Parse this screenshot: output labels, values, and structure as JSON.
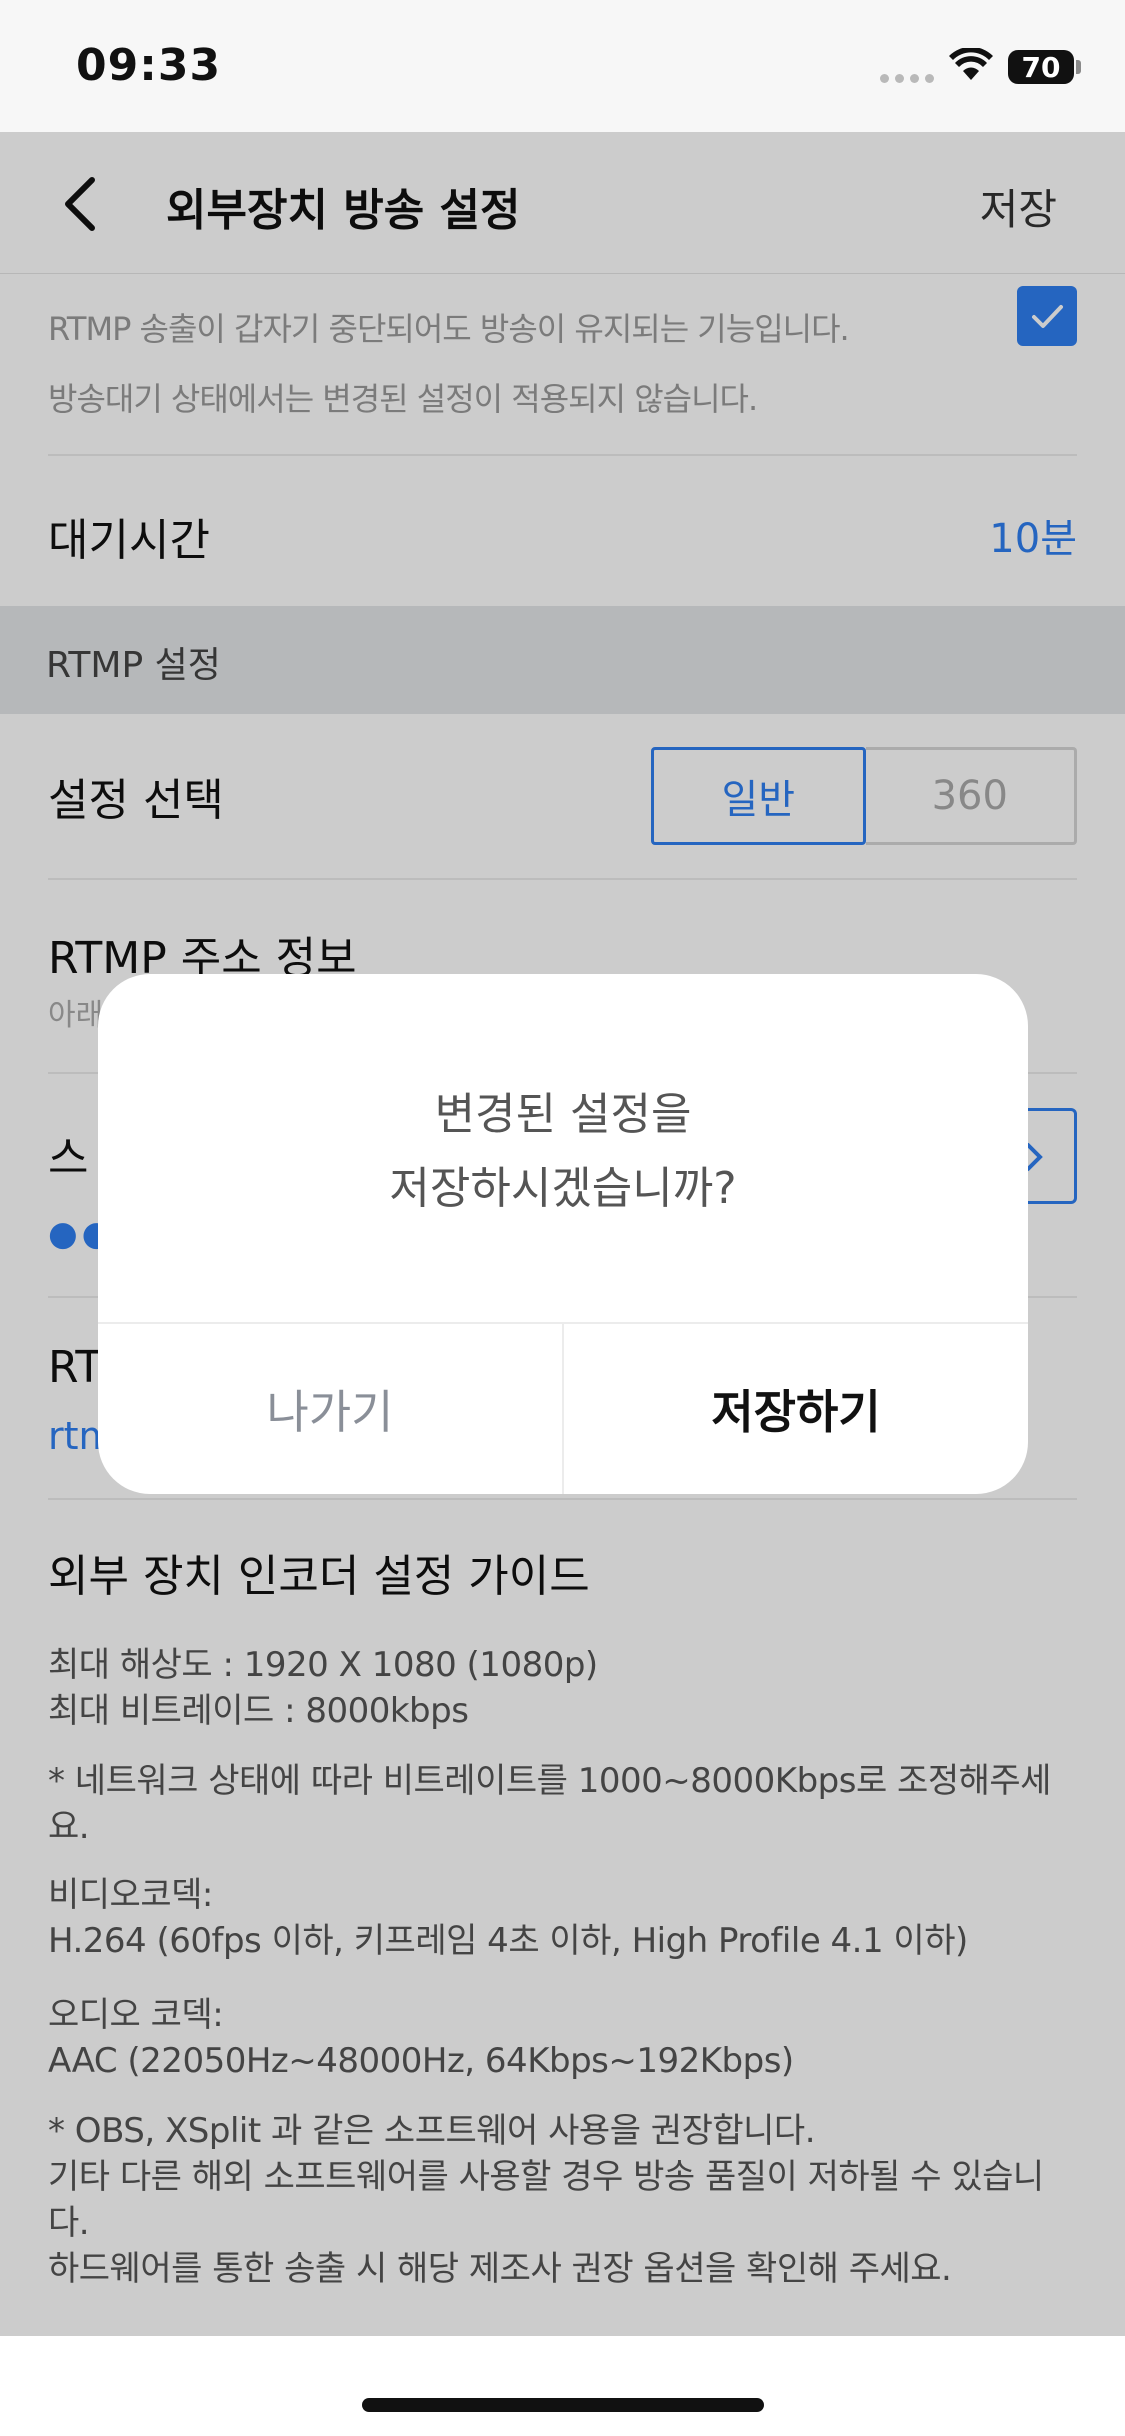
{
  "status_bar": {
    "time": "09:33",
    "battery": "70"
  },
  "nav": {
    "title": "외부장치 방송 설정",
    "save": "저장"
  },
  "description": {
    "line1": "RTMP 송출이 갑자기 중단되어도 방송이 유지되는 기능입니다.",
    "line2": "방송대기 상태에서는 변경된 설정이 적용되지 않습니다."
  },
  "wait_time": {
    "label": "대기시간",
    "value": "10분"
  },
  "section": {
    "title": "RTMP 설정"
  },
  "setting_select": {
    "label": "설정 선택",
    "options": [
      "일반",
      "360"
    ],
    "selected": "일반"
  },
  "rtmp_address": {
    "label": "RTMP 주소 정보",
    "sub_partial": "아래",
    "stream_partial": "스",
    "masked": "●●",
    "rt_partial": "RT",
    "link_partial": "rtm"
  },
  "guide": {
    "title": "외부 장치 인코더 설정 가이드",
    "resolution": "최대 해상도 : 1920 X 1080 (1080p)",
    "bitrate": "최대 비트레이드 : 8000kbps",
    "note1a": "* 네트워크 상태에 따라 비트레이트를 1000~8000Kbps로 조정해주세",
    "note1b": "요.",
    "video_codec_label": "비디오코덱:",
    "video_codec": "H.264 (60fps 이하, 키프레임 4초 이하, High Profile 4.1 이하)",
    "audio_codec_label": "오디오 코덱:",
    "audio_codec": "AAC (22050Hz~48000Hz, 64Kbps~192Kbps)",
    "note2": "* OBS, XSplit 과 같은 소프트웨어 사용을 권장합니다.",
    "note3a": "기타 다른 해외 소프트웨어를 사용할 경우 방송 품질이 저하될 수 있습니",
    "note3b": "다.",
    "note4": "하드웨어를 통한 송출 시 해당 제조사 권장 옵션을 확인해 주세요."
  },
  "dialog": {
    "message_line1": "변경된 설정을",
    "message_line2": "저장하시겠습니까?",
    "cancel": "나가기",
    "confirm": "저장하기"
  },
  "colors": {
    "accent": "#2f7ff0",
    "overlay": "rgba(0,0,0,0.2)"
  }
}
